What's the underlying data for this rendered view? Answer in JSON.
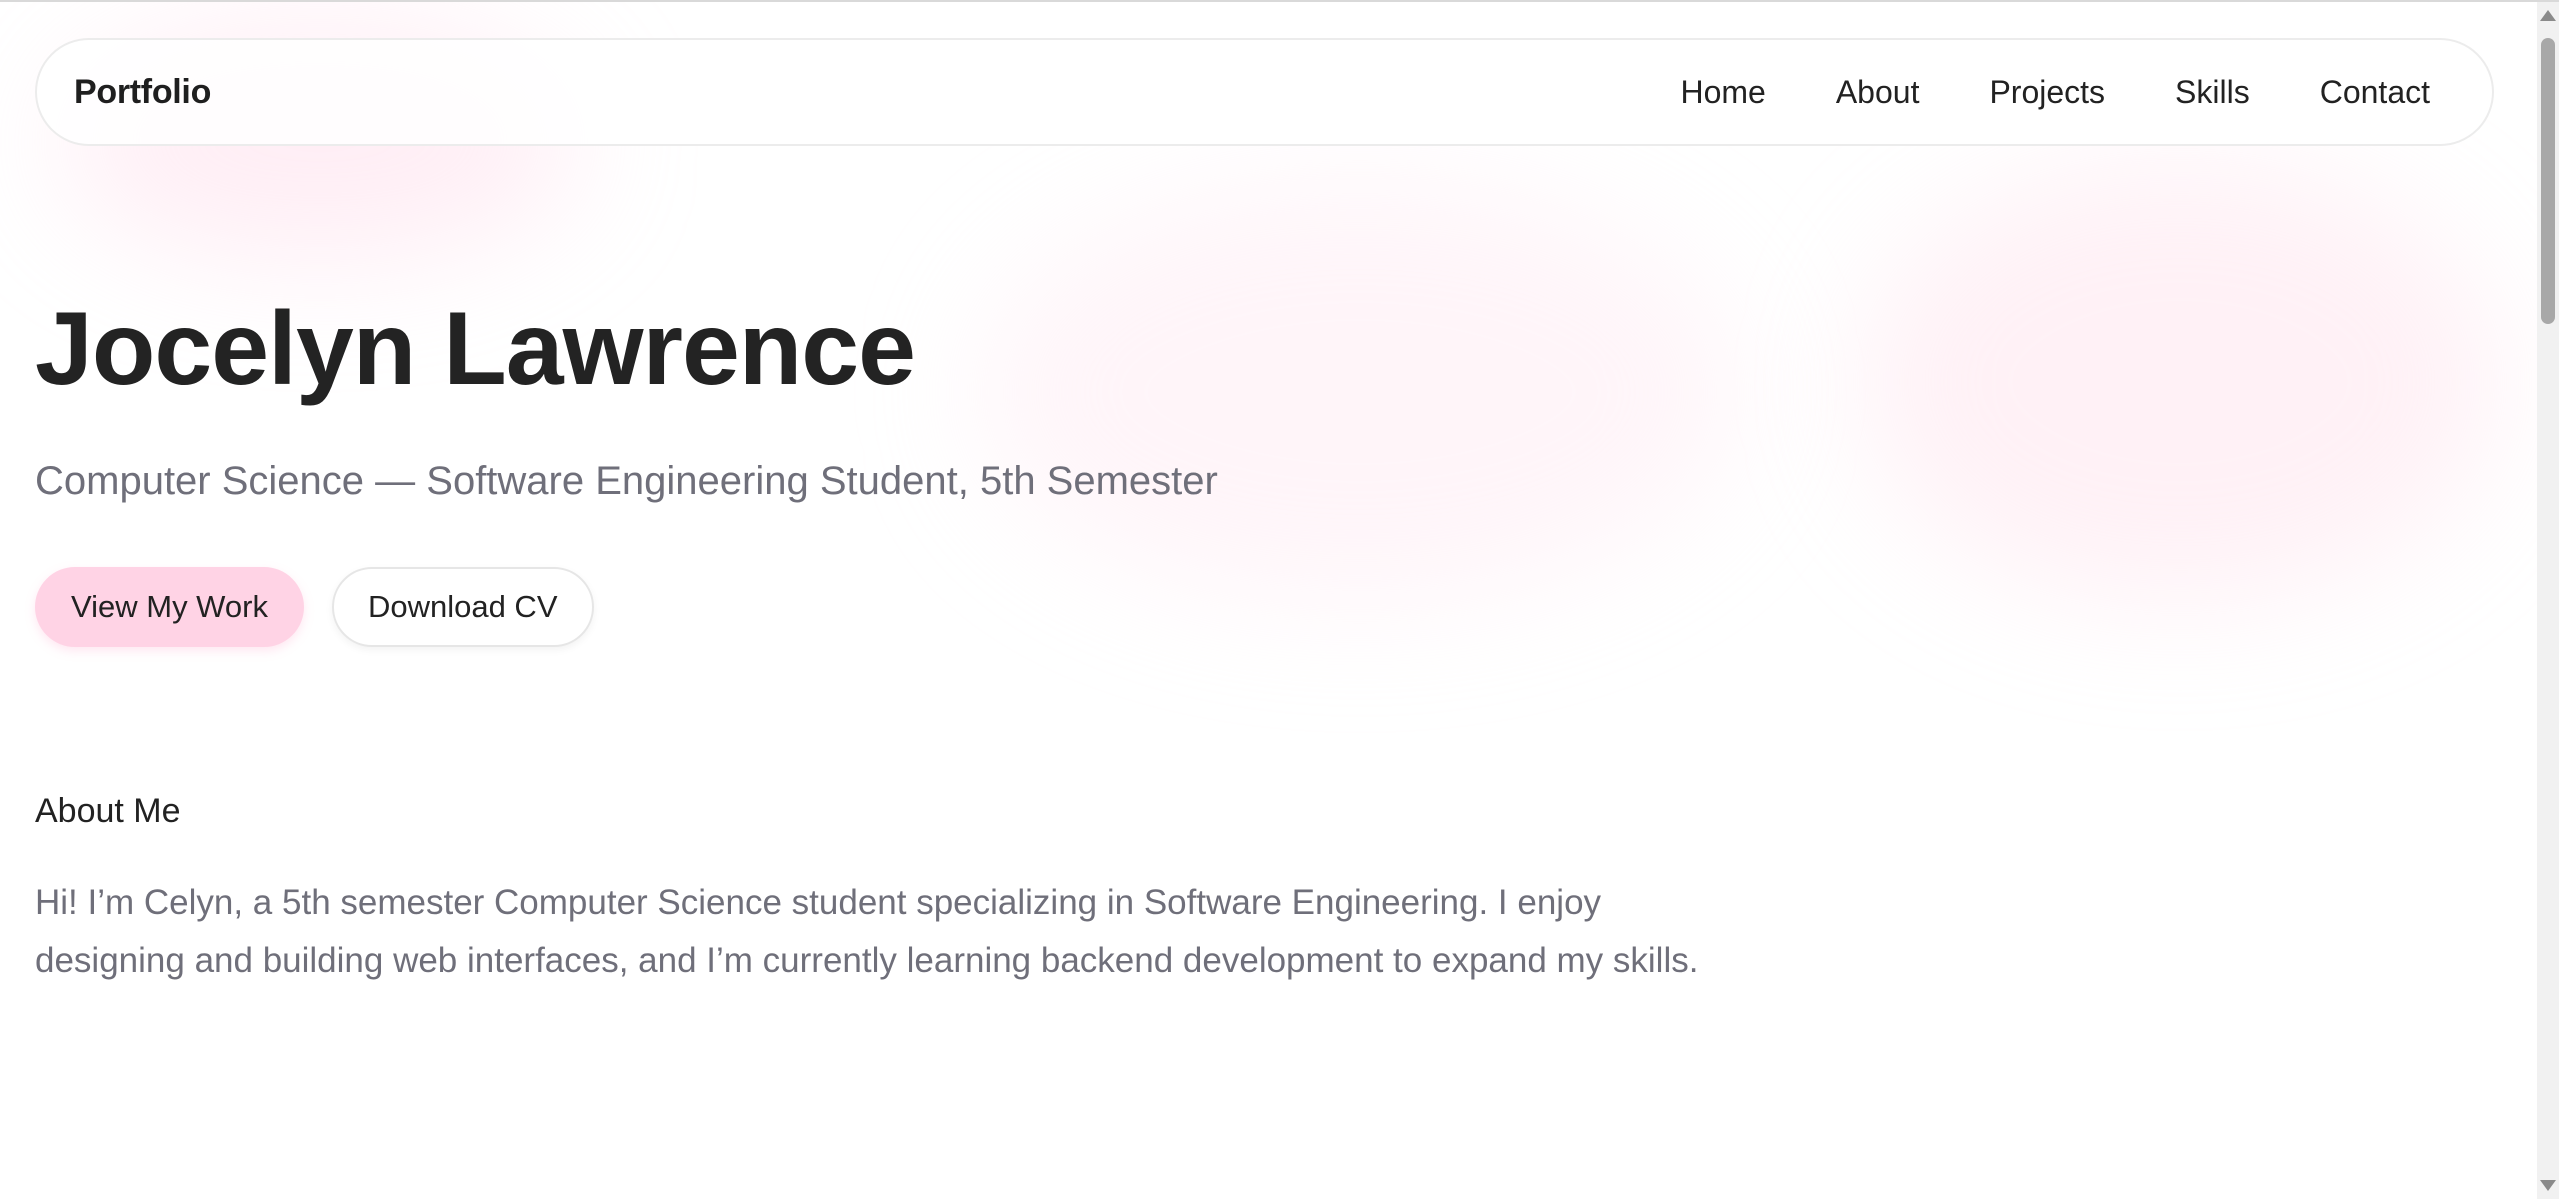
{
  "nav": {
    "brand": "Portfolio",
    "links": [
      "Home",
      "About",
      "Projects",
      "Skills",
      "Contact"
    ]
  },
  "hero": {
    "name": "Jocelyn Lawrence",
    "subtitle": "Computer Science — Software Engineering Student, 5th Semester",
    "primary_button": "View My Work",
    "secondary_button": "Download CV"
  },
  "about": {
    "title": "About Me",
    "text": "Hi! I’m Celyn, a 5th semester Computer Science student specializing in Software Engineering. I enjoy designing and building web interfaces, and I’m currently learning backend development to expand my skills."
  },
  "colors": {
    "accent": "#ffd3e5",
    "text_dark": "#232323",
    "text_muted": "#6f6f7a"
  }
}
